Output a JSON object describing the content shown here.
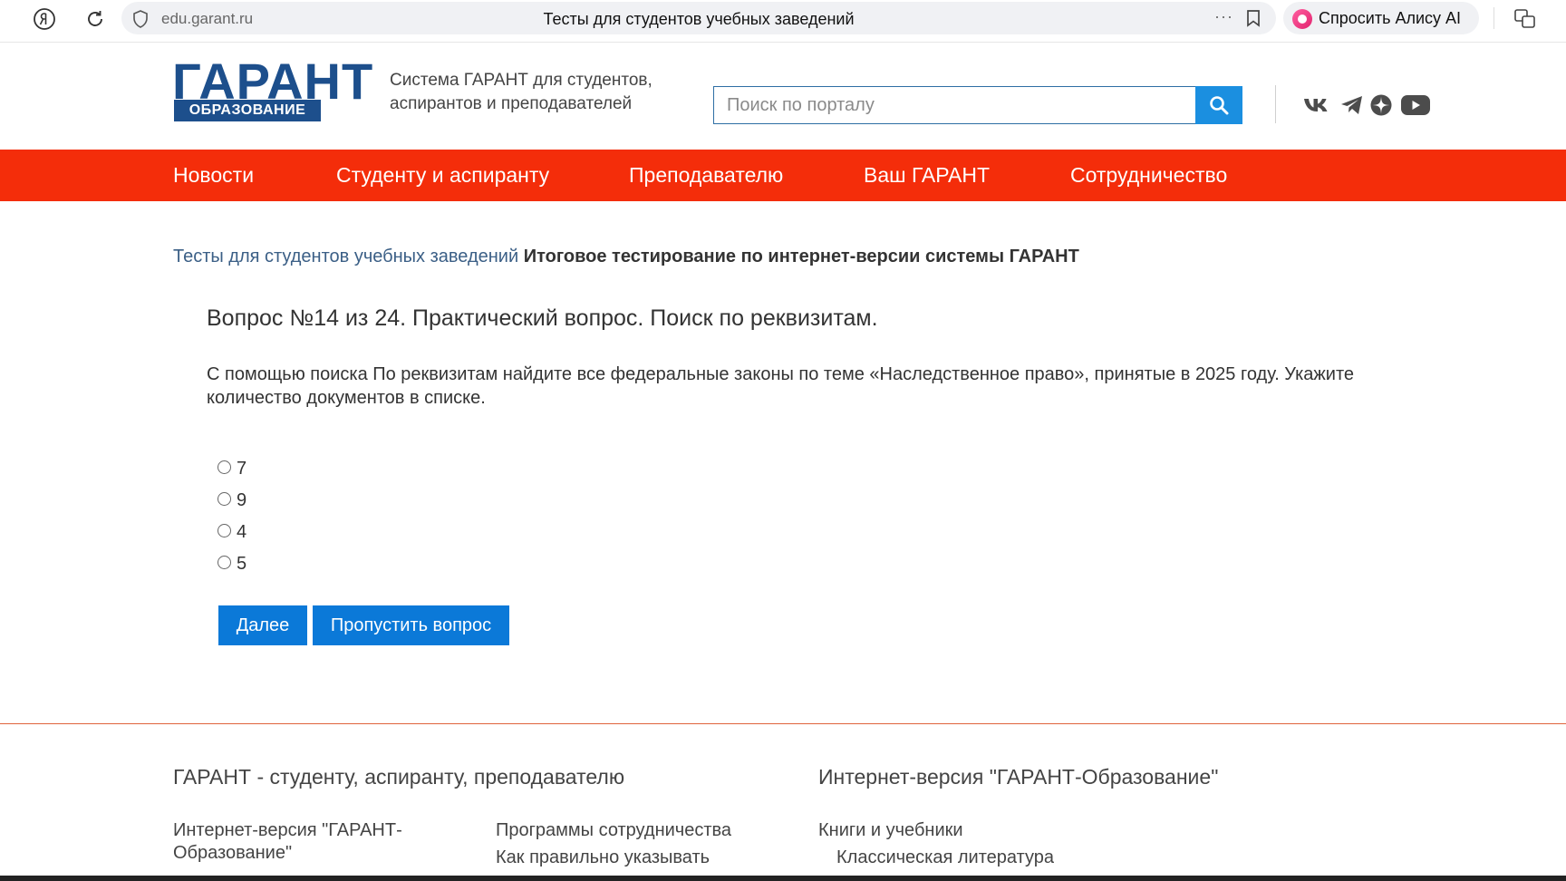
{
  "browser": {
    "url": "edu.garant.ru",
    "tab_title": "Тесты для студентов учебных заведений",
    "more": "···",
    "alice_label": "Спросить Алису AI"
  },
  "header": {
    "logo_main": "ГАРАНТ",
    "logo_sub": "ОБРАЗОВАНИЕ",
    "tagline": "Система ГАРАНТ для студентов, аспирантов и преподавателей",
    "search_placeholder": "Поиск по порталу"
  },
  "social_icons": [
    "vk-icon",
    "telegram-icon",
    "dzen-icon",
    "youtube-icon"
  ],
  "nav": [
    {
      "label": "Новости"
    },
    {
      "label": "Студенту и аспиранту"
    },
    {
      "label": "Преподавателю"
    },
    {
      "label": "Ваш ГАРАНТ"
    },
    {
      "label": "Сотрудничество"
    }
  ],
  "breadcrumb": {
    "link": "Тесты для студентов учебных заведений",
    "current": "Итоговое тестирование по интернет-версии системы ГАРАНТ"
  },
  "question": {
    "title": "Вопрос №14 из 24. Практический вопрос. Поиск по реквизитам.",
    "text": "С помощью поиска По реквизитам найдите все федеральные законы по теме «Наследственное право», принятые в 2025 году. Укажите количество документов в списке.",
    "options": [
      "7",
      "9",
      "4",
      "5"
    ]
  },
  "buttons": {
    "next": "Далее",
    "skip": "Пропустить вопрос"
  },
  "footer": {
    "col1_heading": "ГАРАНТ - студенту, аспиранту, преподавателю",
    "col2_heading": "Интернет-версия \"ГАРАНТ-Образование\"",
    "col1_links": [
      "Интернет-версия \"ГАРАНТ-Образование\""
    ],
    "col2_links": [
      "Программы сотрудничества",
      "Как правильно указывать"
    ],
    "col3_links": [
      "Книги и учебники",
      "Классическая литература"
    ]
  },
  "colors": {
    "nav_bg": "#f42d0a",
    "logo_blue": "#1d4f8c",
    "button_blue": "#0b79d8",
    "search_button": "#1b8fe0"
  }
}
